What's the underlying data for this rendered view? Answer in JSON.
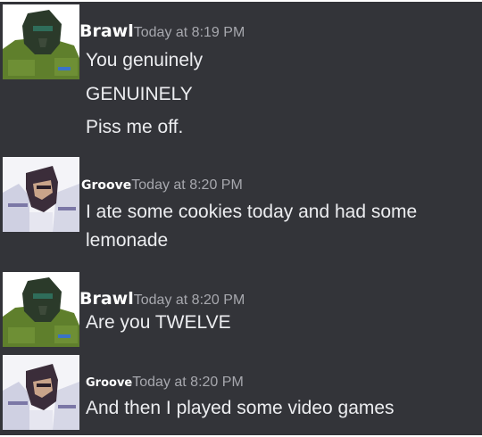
{
  "messages": [
    {
      "author": "Brawl",
      "timestamp": "Today at 8:19 PM",
      "avatar_icon": "brawl-avatar-icon",
      "lines": [
        "You genuinely",
        "GENUINELY",
        "Piss me off."
      ]
    },
    {
      "author": "Groove",
      "timestamp": "Today at 8:20 PM",
      "avatar_icon": "groove-avatar-icon",
      "lines": [
        "I ate some cookies today and had some",
        "lemonade"
      ]
    },
    {
      "author": "Brawl",
      "timestamp": "Today at 8:20 PM",
      "avatar_icon": "brawl-avatar-icon",
      "lines": [
        "Are you TWELVE"
      ]
    },
    {
      "author": "Groove",
      "timestamp": "Today at 8:20 PM",
      "avatar_icon": "groove-avatar-icon",
      "lines": [
        "And then I played some video games"
      ]
    }
  ],
  "colors": {
    "background": "#333439",
    "author": "#ffffff",
    "timestamp": "#a7a8ae",
    "message_text": "#ecedf0"
  }
}
